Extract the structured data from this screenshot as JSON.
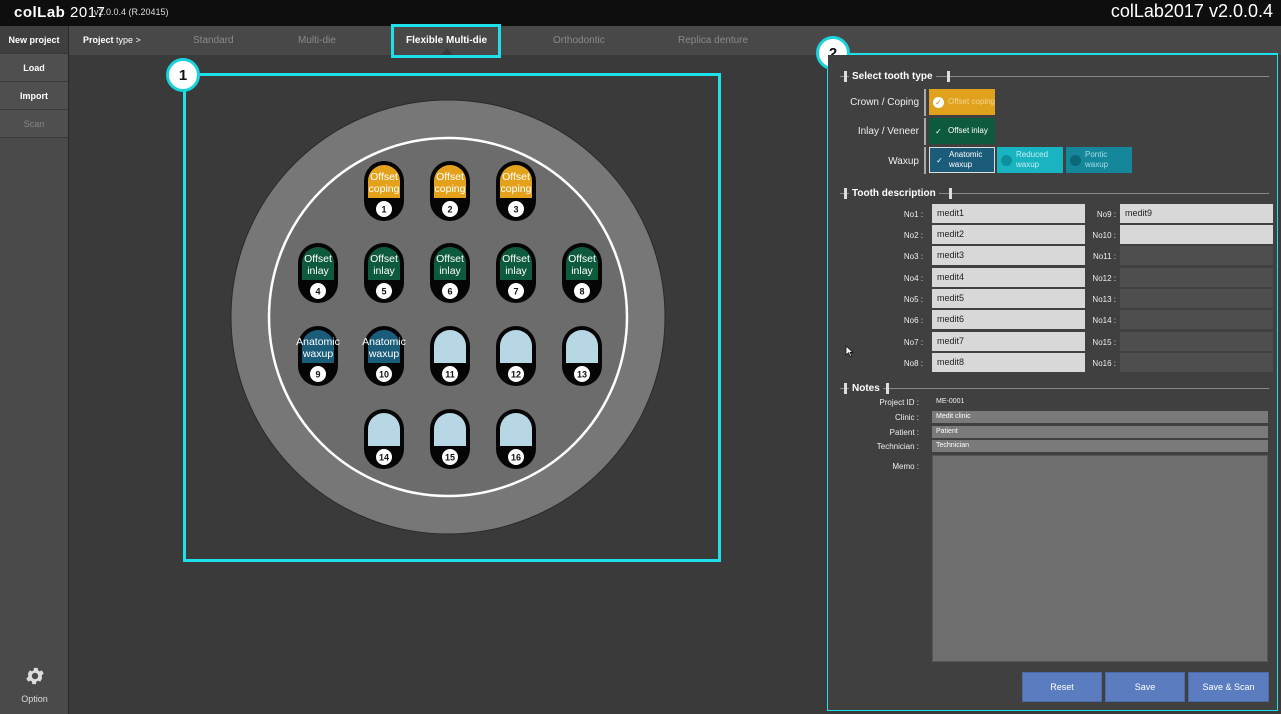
{
  "app": {
    "logo_text": "colLab",
    "logo_year": "2017",
    "logo_version": "v2.0.0.4  (R.20415)",
    "window_title": "colLab2017 v2.0.0.4"
  },
  "sidebar": {
    "items": [
      {
        "label": "New project",
        "enabled": true
      },
      {
        "label": "Load",
        "enabled": true
      },
      {
        "label": "Import",
        "enabled": true
      },
      {
        "label": "Scan",
        "enabled": false
      }
    ],
    "option_label": "Option",
    "option_icon": "gear-icon"
  },
  "project_type": {
    "label_bold": "Project",
    "label_rest": " type >",
    "tabs": [
      {
        "label": "Standard",
        "active": false
      },
      {
        "label": "Multi-die",
        "active": false
      },
      {
        "label": "Flexible Multi-die",
        "active": true
      },
      {
        "label": "Orthodontic",
        "active": false
      },
      {
        "label": "Replica denture",
        "active": false
      }
    ]
  },
  "callouts": [
    "1",
    "2"
  ],
  "tray": {
    "dies": [
      {
        "number": "1",
        "label": "Offset coping",
        "type": "coping"
      },
      {
        "number": "2",
        "label": "Offset coping",
        "type": "coping"
      },
      {
        "number": "3",
        "label": "Offset coping",
        "type": "coping"
      },
      {
        "number": "4",
        "label": "Offset inlay",
        "type": "inlay"
      },
      {
        "number": "5",
        "label": "Offset inlay",
        "type": "inlay"
      },
      {
        "number": "6",
        "label": "Offset inlay",
        "type": "inlay"
      },
      {
        "number": "7",
        "label": "Offset inlay",
        "type": "inlay"
      },
      {
        "number": "8",
        "label": "Offset inlay",
        "type": "inlay"
      },
      {
        "number": "9",
        "label": "Anatomic waxup",
        "type": "waxup"
      },
      {
        "number": "10",
        "label": "Anatomic waxup",
        "type": "waxup"
      },
      {
        "number": "11",
        "label": "",
        "type": "empty"
      },
      {
        "number": "12",
        "label": "",
        "type": "empty"
      },
      {
        "number": "13",
        "label": "",
        "type": "empty"
      },
      {
        "number": "14",
        "label": "",
        "type": "empty"
      },
      {
        "number": "15",
        "label": "",
        "type": "empty"
      },
      {
        "number": "16",
        "label": "",
        "type": "empty"
      }
    ],
    "colors": {
      "coping": "#e4a21c",
      "inlay": "#0d5a3c",
      "waxup": "#1b5c7a",
      "empty": "#b6d7e3"
    }
  },
  "tooth_type": {
    "title": "Select tooth type",
    "crown_label": "Crown / Coping",
    "crown_option": "Offset coping",
    "inlay_label": "Inlay / Veneer",
    "inlay_option": "Offset inlay",
    "waxup_label": "Waxup",
    "waxup_options": [
      "Anatomic waxup",
      "Reduced waxup",
      "Pontic waxup"
    ]
  },
  "tooth_description": {
    "title": "Tooth description",
    "left": [
      {
        "label": "No1 :",
        "value": "medit1"
      },
      {
        "label": "No2 :",
        "value": "medit2"
      },
      {
        "label": "No3 :",
        "value": "medit3"
      },
      {
        "label": "No4 :",
        "value": "medit4"
      },
      {
        "label": "No5 :",
        "value": "medit5"
      },
      {
        "label": "No6 :",
        "value": "medit6"
      },
      {
        "label": "No7 :",
        "value": "medit7"
      },
      {
        "label": "No8 :",
        "value": "medit8"
      }
    ],
    "right": [
      {
        "label": "No9 :",
        "value": "medit9",
        "enabled": true
      },
      {
        "label": "No10 :",
        "value": "",
        "enabled": true
      },
      {
        "label": "No11 :",
        "value": "",
        "enabled": false
      },
      {
        "label": "No12 :",
        "value": "",
        "enabled": false
      },
      {
        "label": "No13 :",
        "value": "",
        "enabled": false
      },
      {
        "label": "No14 :",
        "value": "",
        "enabled": false
      },
      {
        "label": "No15 :",
        "value": "",
        "enabled": false
      },
      {
        "label": "No16 :",
        "value": "",
        "enabled": false
      }
    ]
  },
  "notes": {
    "title": "Notes",
    "project_id_label": "Project ID :",
    "project_id": "ME-0001",
    "clinic_label": "Clinic :",
    "clinic": "Medit clinic",
    "patient_label": "Patient :",
    "patient": "Patient",
    "technician_label": "Technician :",
    "technician": "Technician",
    "memo_label": "Memo :",
    "memo": ""
  },
  "actions": {
    "reset": "Reset",
    "save": "Save",
    "save_scan": "Save & Scan"
  }
}
